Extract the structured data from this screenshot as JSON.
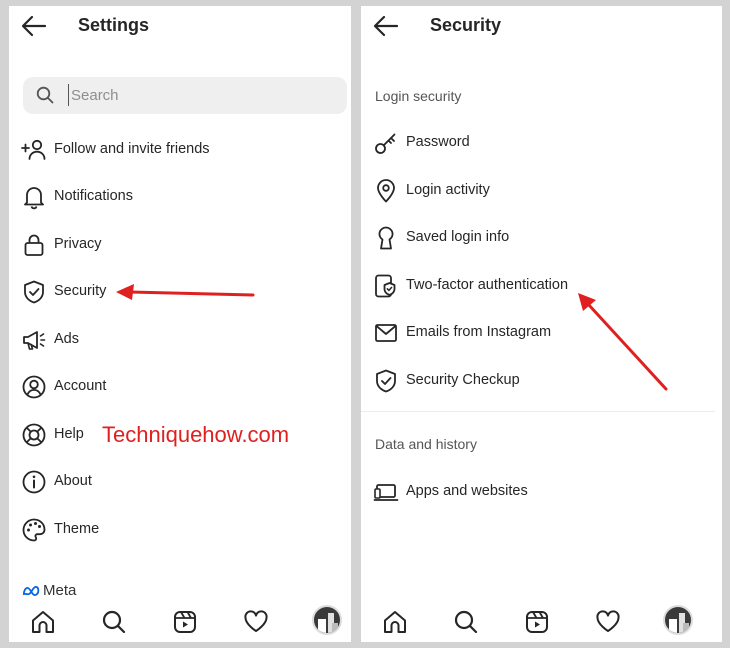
{
  "left_screen": {
    "title": "Settings",
    "search": {
      "placeholder": "Search",
      "value": ""
    },
    "items": [
      {
        "label": "Follow and invite friends",
        "icon": "add-person-icon"
      },
      {
        "label": "Notifications",
        "icon": "bell-icon"
      },
      {
        "label": "Privacy",
        "icon": "lock-icon"
      },
      {
        "label": "Security",
        "icon": "shield-icon"
      },
      {
        "label": "Ads",
        "icon": "megaphone-icon"
      },
      {
        "label": "Account",
        "icon": "account-icon"
      },
      {
        "label": "Help",
        "icon": "lifebuoy-icon"
      },
      {
        "label": "About",
        "icon": "info-icon"
      },
      {
        "label": "Theme",
        "icon": "palette-icon"
      }
    ],
    "footer_brand": "Meta"
  },
  "right_screen": {
    "title": "Security",
    "sections": [
      {
        "title": "Login security",
        "items": [
          {
            "label": "Password",
            "icon": "key-icon"
          },
          {
            "label": "Login activity",
            "icon": "location-pin-icon"
          },
          {
            "label": "Saved login info",
            "icon": "keyhole-icon"
          },
          {
            "label": "Two-factor authentication",
            "icon": "phone-shield-icon"
          },
          {
            "label": "Emails from Instagram",
            "icon": "mail-icon"
          },
          {
            "label": "Security Checkup",
            "icon": "shield-check-icon"
          }
        ]
      },
      {
        "title": "Data and history",
        "items": [
          {
            "label": "Apps and websites",
            "icon": "laptop-icon"
          }
        ]
      }
    ]
  },
  "bottom_nav": [
    "home-icon",
    "search-icon",
    "reels-icon",
    "heart-icon",
    "profile-avatar"
  ],
  "watermark": "Techniquehow.com",
  "colors": {
    "annotation": "#e02020",
    "text": "#262626",
    "muted": "#555555",
    "search_bg": "#efefef"
  }
}
